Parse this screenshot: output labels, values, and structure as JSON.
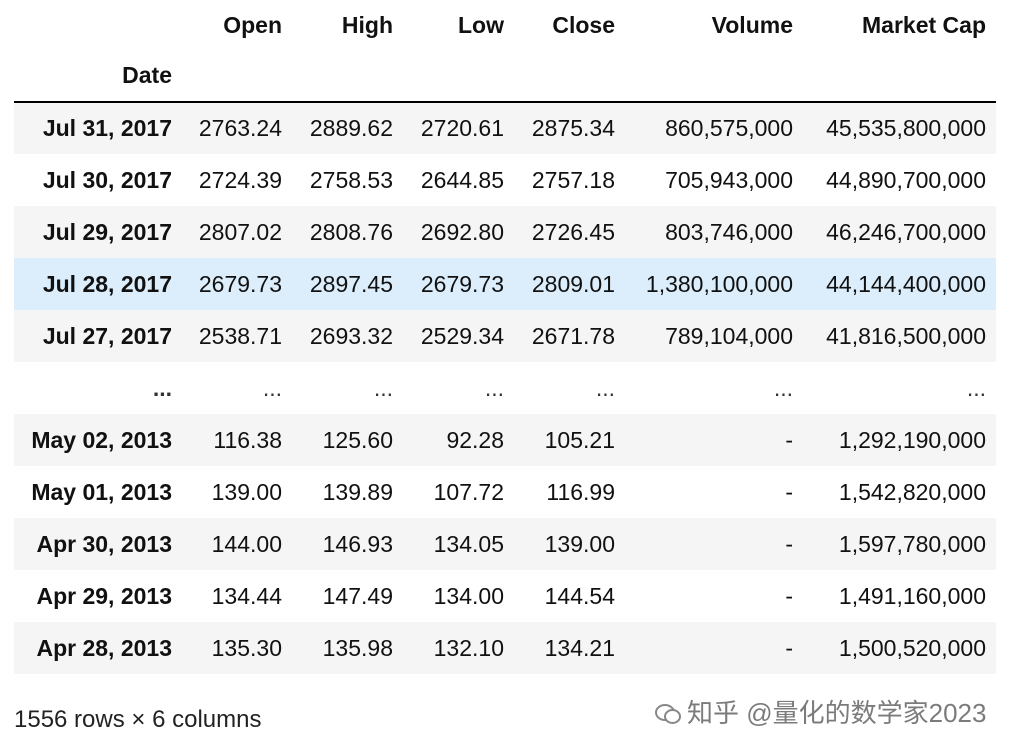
{
  "table": {
    "columns": [
      "Open",
      "High",
      "Low",
      "Close",
      "Volume",
      "Market Cap"
    ],
    "index_name": "Date",
    "rows": [
      {
        "date": "Jul 31, 2017",
        "open": "2763.24",
        "high": "2889.62",
        "low": "2720.61",
        "close": "2875.34",
        "volume": "860,575,000",
        "market_cap": "45,535,800,000"
      },
      {
        "date": "Jul 30, 2017",
        "open": "2724.39",
        "high": "2758.53",
        "low": "2644.85",
        "close": "2757.18",
        "volume": "705,943,000",
        "market_cap": "44,890,700,000"
      },
      {
        "date": "Jul 29, 2017",
        "open": "2807.02",
        "high": "2808.76",
        "low": "2692.80",
        "close": "2726.45",
        "volume": "803,746,000",
        "market_cap": "46,246,700,000"
      },
      {
        "date": "Jul 28, 2017",
        "open": "2679.73",
        "high": "2897.45",
        "low": "2679.73",
        "close": "2809.01",
        "volume": "1,380,100,000",
        "market_cap": "44,144,400,000"
      },
      {
        "date": "Jul 27, 2017",
        "open": "2538.71",
        "high": "2693.32",
        "low": "2529.34",
        "close": "2671.78",
        "volume": "789,104,000",
        "market_cap": "41,816,500,000"
      },
      {
        "date": "...",
        "open": "...",
        "high": "...",
        "low": "...",
        "close": "...",
        "volume": "...",
        "market_cap": "..."
      },
      {
        "date": "May 02, 2013",
        "open": "116.38",
        "high": "125.60",
        "low": "92.28",
        "close": "105.21",
        "volume": "-",
        "market_cap": "1,292,190,000"
      },
      {
        "date": "May 01, 2013",
        "open": "139.00",
        "high": "139.89",
        "low": "107.72",
        "close": "116.99",
        "volume": "-",
        "market_cap": "1,542,820,000"
      },
      {
        "date": "Apr 30, 2013",
        "open": "144.00",
        "high": "146.93",
        "low": "134.05",
        "close": "139.00",
        "volume": "-",
        "market_cap": "1,597,780,000"
      },
      {
        "date": "Apr 29, 2013",
        "open": "134.44",
        "high": "147.49",
        "low": "134.00",
        "close": "144.54",
        "volume": "-",
        "market_cap": "1,491,160,000"
      },
      {
        "date": "Apr 28, 2013",
        "open": "135.30",
        "high": "135.98",
        "low": "132.10",
        "close": "134.21",
        "volume": "-",
        "market_cap": "1,500,520,000"
      }
    ]
  },
  "shape_text": "1556 rows × 6 columns",
  "watermark": {
    "text": "知乎 @量化的数学家2023",
    "icon": "wechat-bubbles-icon"
  },
  "colors": {
    "row_stripe": "#f5f5f5",
    "row_hover": "#dceefc",
    "header_rule": "#000000"
  }
}
